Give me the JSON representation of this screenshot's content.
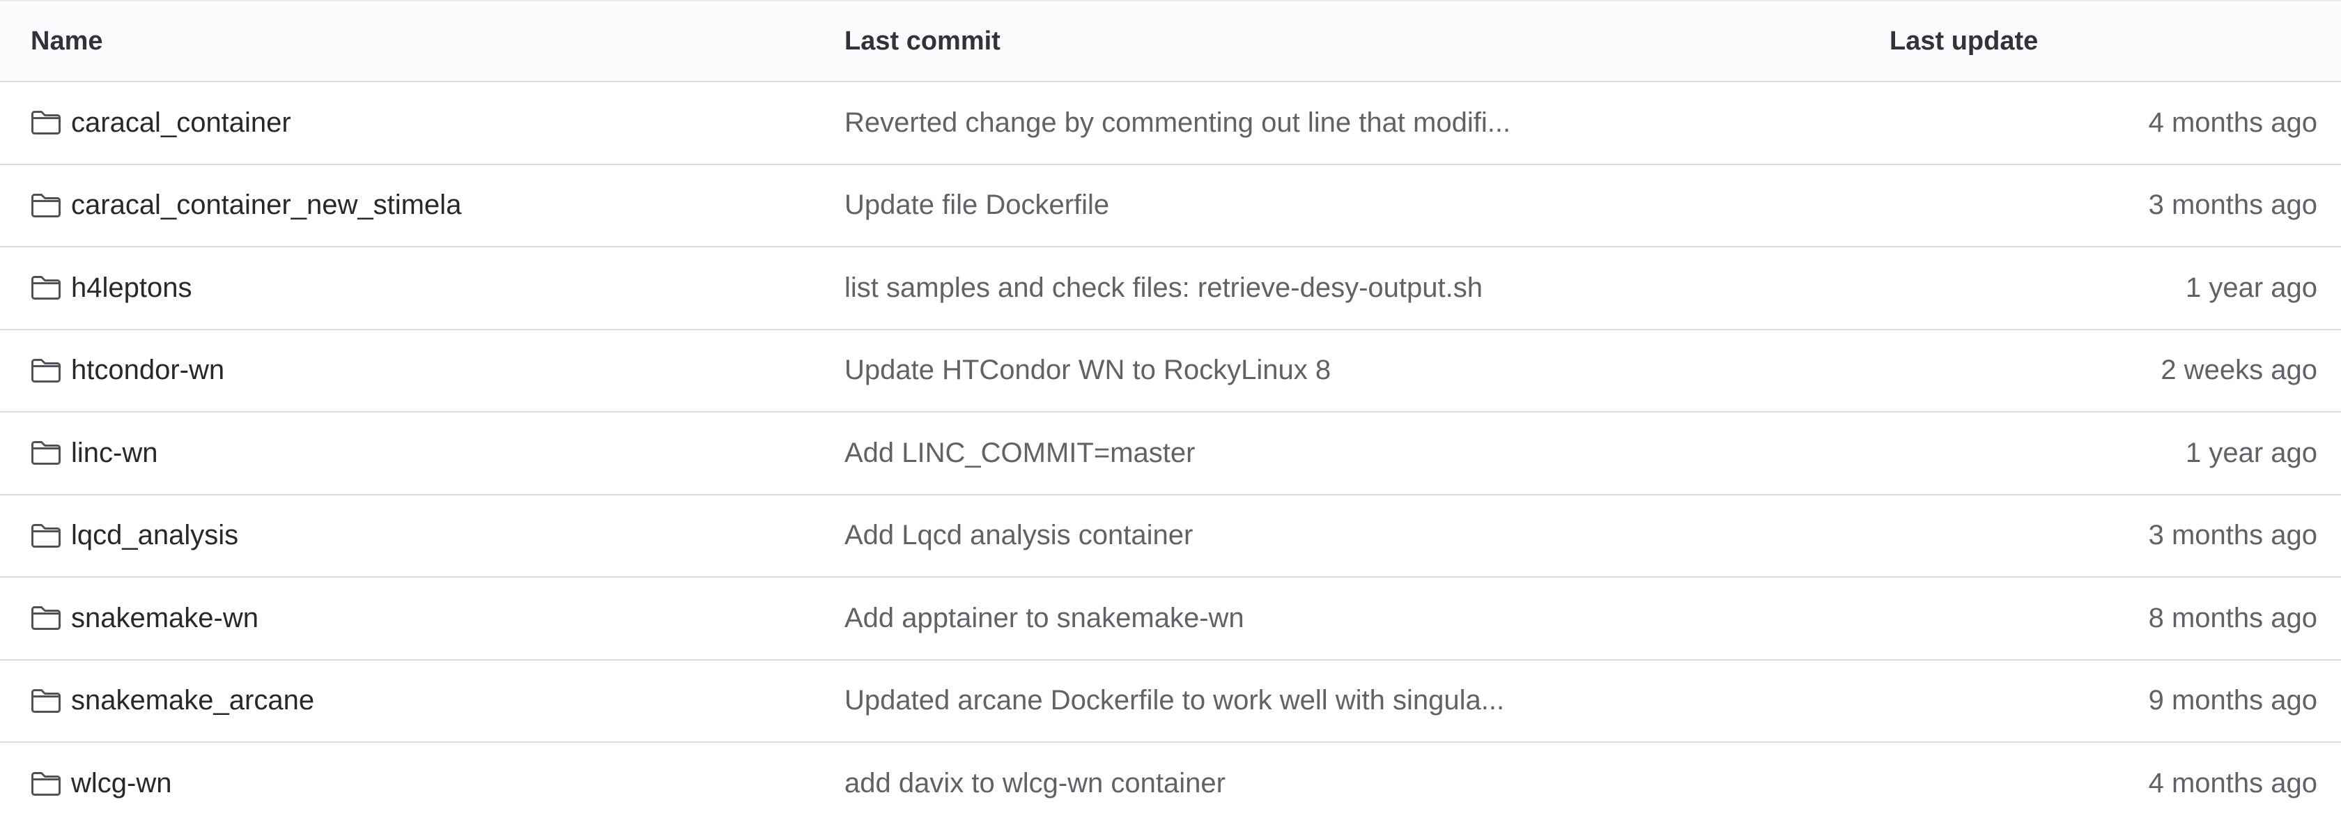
{
  "header": {
    "name": "Name",
    "last_commit": "Last commit",
    "last_update": "Last update"
  },
  "colors": {
    "header_bg": "#fbfafd",
    "border": "#dcdcde",
    "text_primary": "#28272d",
    "text_secondary": "#626168"
  },
  "rows": [
    {
      "icon": "folder-icon",
      "name": "caracal_container",
      "commit": "Reverted change by commenting out line that modifi...",
      "updated": "4 months ago"
    },
    {
      "icon": "folder-icon",
      "name": "caracal_container_new_stimela",
      "commit": "Update file Dockerfile",
      "updated": "3 months ago"
    },
    {
      "icon": "folder-icon",
      "name": "h4leptons",
      "commit": "list samples and check files: retrieve-desy-output.sh",
      "updated": "1 year ago"
    },
    {
      "icon": "folder-icon",
      "name": "htcondor-wn",
      "commit": "Update HTCondor WN to RockyLinux 8",
      "updated": "2 weeks ago"
    },
    {
      "icon": "folder-icon",
      "name": "linc-wn",
      "commit": "Add LINC_COMMIT=master",
      "updated": "1 year ago"
    },
    {
      "icon": "folder-icon",
      "name": "lqcd_analysis",
      "commit": "Add Lqcd analysis container",
      "updated": "3 months ago"
    },
    {
      "icon": "folder-icon",
      "name": "snakemake-wn",
      "commit": "Add apptainer to snakemake-wn",
      "updated": "8 months ago"
    },
    {
      "icon": "folder-icon",
      "name": "snakemake_arcane",
      "commit": "Updated arcane Dockerfile to work well with singula...",
      "updated": "9 months ago"
    },
    {
      "icon": "folder-icon",
      "name": "wlcg-wn",
      "commit": "add davix to wlcg-wn container",
      "updated": "4 months ago"
    }
  ]
}
